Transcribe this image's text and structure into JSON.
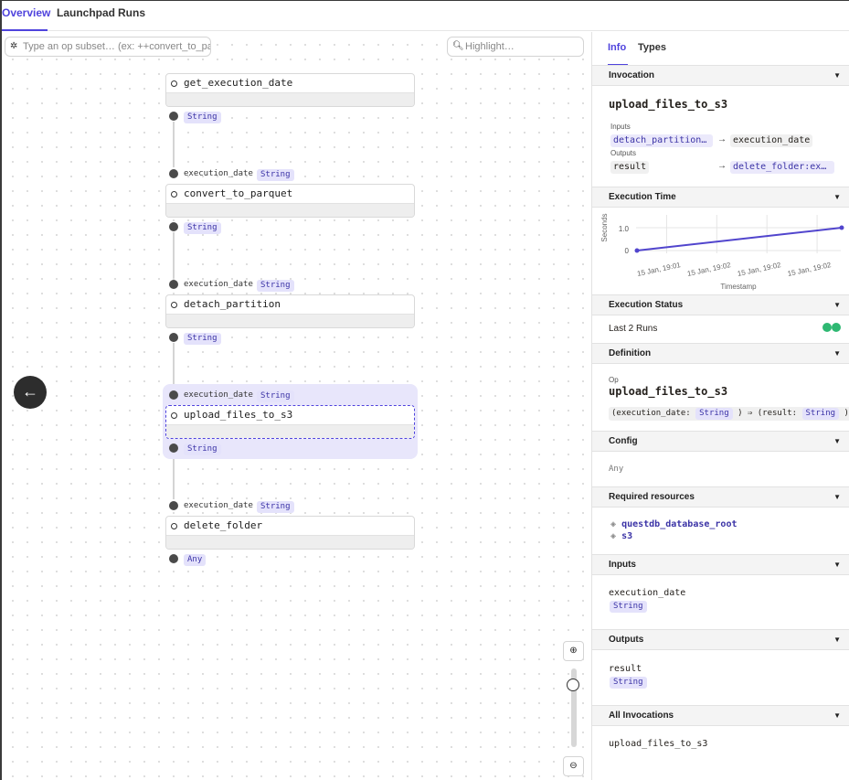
{
  "tabs": [
    {
      "label": "Overview",
      "active": true
    },
    {
      "label": "Launchpad",
      "active": false
    },
    {
      "label": "Runs",
      "active": false
    }
  ],
  "graph": {
    "subset_placeholder": "Type an op subset… (ex: ++convert_to_par",
    "highlight_placeholder": "Highlight…",
    "ops": [
      {
        "name": "get_execution_date",
        "input": null,
        "output": "String"
      },
      {
        "name": "convert_to_parquet",
        "input": {
          "name": "execution_date",
          "type": "String"
        },
        "output": "String"
      },
      {
        "name": "detach_partition",
        "input": {
          "name": "execution_date",
          "type": "String"
        },
        "output": "String"
      },
      {
        "name": "upload_files_to_s3",
        "input": {
          "name": "execution_date",
          "type": "String"
        },
        "output": "String",
        "selected": true
      },
      {
        "name": "delete_folder",
        "input": {
          "name": "execution_date",
          "type": "String"
        },
        "output": "Any"
      }
    ]
  },
  "panel": {
    "tabs": [
      {
        "label": "Info",
        "active": true
      },
      {
        "label": "Types",
        "active": false
      }
    ],
    "invocation": {
      "header": "Invocation",
      "name": "upload_files_to_s3",
      "inputs_label": "Inputs",
      "input_from": "detach_partition…",
      "input_to": "execution_date",
      "outputs_label": "Outputs",
      "output_from": "result",
      "output_to": "delete_folder:ex…"
    },
    "execution_time": {
      "header": "Execution Time",
      "ylabel": "Seconds",
      "xlabel": "Timestamp",
      "chart_data": {
        "type": "line",
        "x": [
          "15 Jan, 19:01",
          "15 Jan, 19:02"
        ],
        "values": [
          0,
          1.0
        ],
        "xticks": [
          "15 Jan, 19:01",
          "15 Jan, 19:02",
          "15 Jan, 19:02",
          "15 Jan, 19:02"
        ],
        "yticks": [
          "0",
          "1.0"
        ],
        "color": "#5145cd"
      }
    },
    "execution_status": {
      "header": "Execution Status",
      "label": "Last 2 Runs",
      "run_colors": [
        "#2eb872",
        "#2eb872"
      ]
    },
    "definition": {
      "header": "Definition",
      "kind": "Op",
      "name": "upload_files_to_s3",
      "sig_open": "(execution_date:",
      "sig_in_type": "String",
      "sig_mid": ") ⇒ (result:",
      "sig_out_type": "String",
      "sig_close": ")"
    },
    "config": {
      "header": "Config",
      "value": "Any"
    },
    "resources": {
      "header": "Required resources",
      "items": [
        "questdb_database_root",
        "s3"
      ]
    },
    "inputs": {
      "header": "Inputs",
      "name": "execution_date",
      "type": "String"
    },
    "outputs": {
      "header": "Outputs",
      "name": "result",
      "type": "String"
    },
    "all_invocations": {
      "header": "All Invocations",
      "name": "upload_files_to_s3"
    }
  }
}
